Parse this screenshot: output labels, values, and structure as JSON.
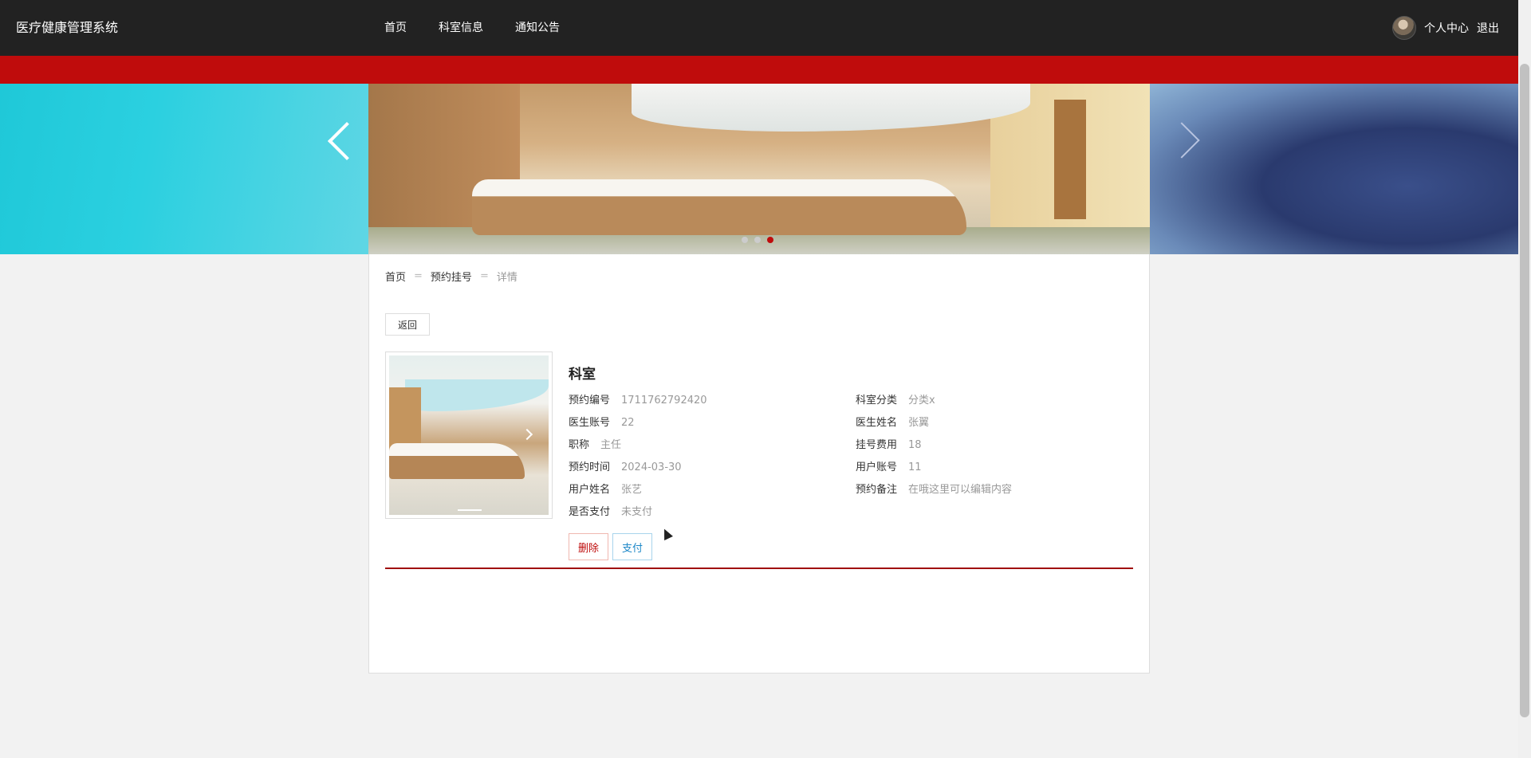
{
  "header": {
    "brand": "医疗健康管理系统",
    "nav": [
      "首页",
      "科室信息",
      "通知公告"
    ],
    "user_center": "个人中心",
    "logout": "退出"
  },
  "banner": {
    "active_dot": 3,
    "dot_count": 3
  },
  "breadcrumb": {
    "home": "首页",
    "section": "预约挂号",
    "current": "详情",
    "sep": "="
  },
  "back_label": "返回",
  "detail": {
    "title": "科室",
    "fields_left": [
      {
        "k": "预约编号",
        "v": "1711762792420"
      },
      {
        "k": "医生账号",
        "v": "22"
      },
      {
        "k": "职称",
        "v": "主任"
      },
      {
        "k": "预约时间",
        "v": "2024-03-30"
      },
      {
        "k": "用户姓名",
        "v": "张艺"
      },
      {
        "k": "是否支付",
        "v": "未支付"
      }
    ],
    "fields_right": [
      {
        "k": "科室分类",
        "v": "分类x"
      },
      {
        "k": "医生姓名",
        "v": "张翼"
      },
      {
        "k": "挂号费用",
        "v": "18"
      },
      {
        "k": "用户账号",
        "v": "11"
      },
      {
        "k": "预约备注",
        "v": "在哦这里可以编辑内容"
      }
    ]
  },
  "actions": {
    "delete": "删除",
    "pay": "支付"
  },
  "colors": {
    "topbar": "#222222",
    "accent": "#bf0c0c",
    "pay": "#1e88c8"
  }
}
